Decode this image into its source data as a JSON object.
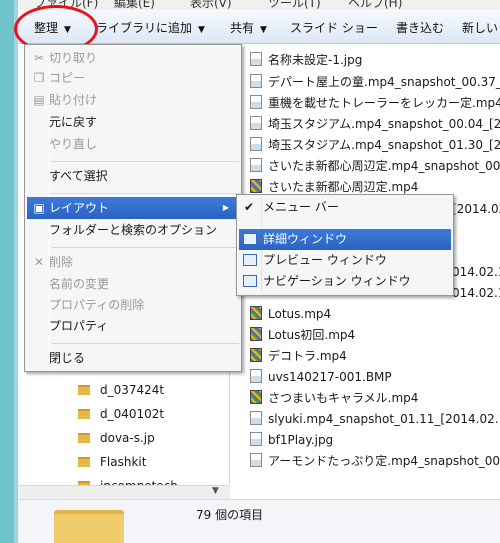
{
  "menubar": {
    "items": [
      "ファイル(F)",
      "編集(E)",
      "表示(V)",
      "ツール(T)",
      "ヘルプ(H)"
    ]
  },
  "toolbar": {
    "organize": "整理",
    "library": "ライブラリに追加",
    "share": "共有",
    "slideshow": "スライド ショー",
    "burn": "書き込む",
    "new": "新しい"
  },
  "menu": {
    "items": [
      {
        "label": "切り取り",
        "enabled": false
      },
      {
        "label": "コピー",
        "enabled": false
      },
      {
        "label": "貼り付け",
        "enabled": false
      },
      {
        "label": "元に戻す",
        "enabled": true
      },
      {
        "label": "やり直し",
        "enabled": false
      },
      {
        "label": "すべて選択",
        "enabled": true
      },
      {
        "label": "レイアウト",
        "enabled": true
      },
      {
        "label": "フォルダーと検索のオプション",
        "enabled": true
      },
      {
        "label": "削除",
        "enabled": false
      },
      {
        "label": "名前の変更",
        "enabled": false
      },
      {
        "label": "プロパティの削除",
        "enabled": false
      },
      {
        "label": "プロパティ",
        "enabled": true
      },
      {
        "label": "閉じる",
        "enabled": true
      }
    ]
  },
  "submenu": {
    "items": [
      {
        "label": "メニュー バー",
        "checked": true
      },
      {
        "label": "詳細ウィンドウ"
      },
      {
        "label": "プレビュー ウィンドウ"
      },
      {
        "label": "ナビゲーション ウィンドウ"
      }
    ]
  },
  "nav": {
    "folders": [
      "d_037424t",
      "d_040102t",
      "dova-s.jp",
      "Flashkit",
      "incompetech"
    ]
  },
  "files": [
    {
      "name": "名称未設定-1.jpg",
      "type": "image"
    },
    {
      "name": "デパート屋上の童.mp4_snapshot_00.37_",
      "type": "image"
    },
    {
      "name": "重機を載せたトレーラーをレッカー定.mp4",
      "type": "image"
    },
    {
      "name": "埼玉スタジアム.mp4_snapshot_00.04_[2",
      "type": "image"
    },
    {
      "name": "埼玉スタジアム.mp4_snapshot_01.30_[2",
      "type": "image"
    },
    {
      "name": "さいたま新都心周辺定.mp4_snapshot_00.",
      "type": "image"
    },
    {
      "name": "さいたま新都心周辺定.mp4",
      "type": "video"
    },
    {
      "name": "[2014.02",
      "type": "none"
    },
    {
      "name": "014.02.1",
      "type": "none"
    },
    {
      "name": "014.02.1",
      "type": "none"
    },
    {
      "name": "Lotus.mp4",
      "type": "video"
    },
    {
      "name": "Lotus初回.mp4",
      "type": "video"
    },
    {
      "name": "デコトラ.mp4",
      "type": "video"
    },
    {
      "name": "uvs140217-001.BMP",
      "type": "image"
    },
    {
      "name": "さつまいもキャラメル.mp4",
      "type": "video"
    },
    {
      "name": "slyuki.mp4_snapshot_01.11_[2014.02.15",
      "type": "image"
    },
    {
      "name": "bf1Play.jpg",
      "type": "image"
    },
    {
      "name": "アーモンドたっぷり定.mp4_snapshot_00.",
      "type": "image"
    }
  ],
  "status": {
    "item_count": "79 個の項目"
  },
  "colors": {
    "highlight": "#2a62c4",
    "annotation_circle": "#e8121c",
    "desktop_edge": "#6fc4cc"
  }
}
